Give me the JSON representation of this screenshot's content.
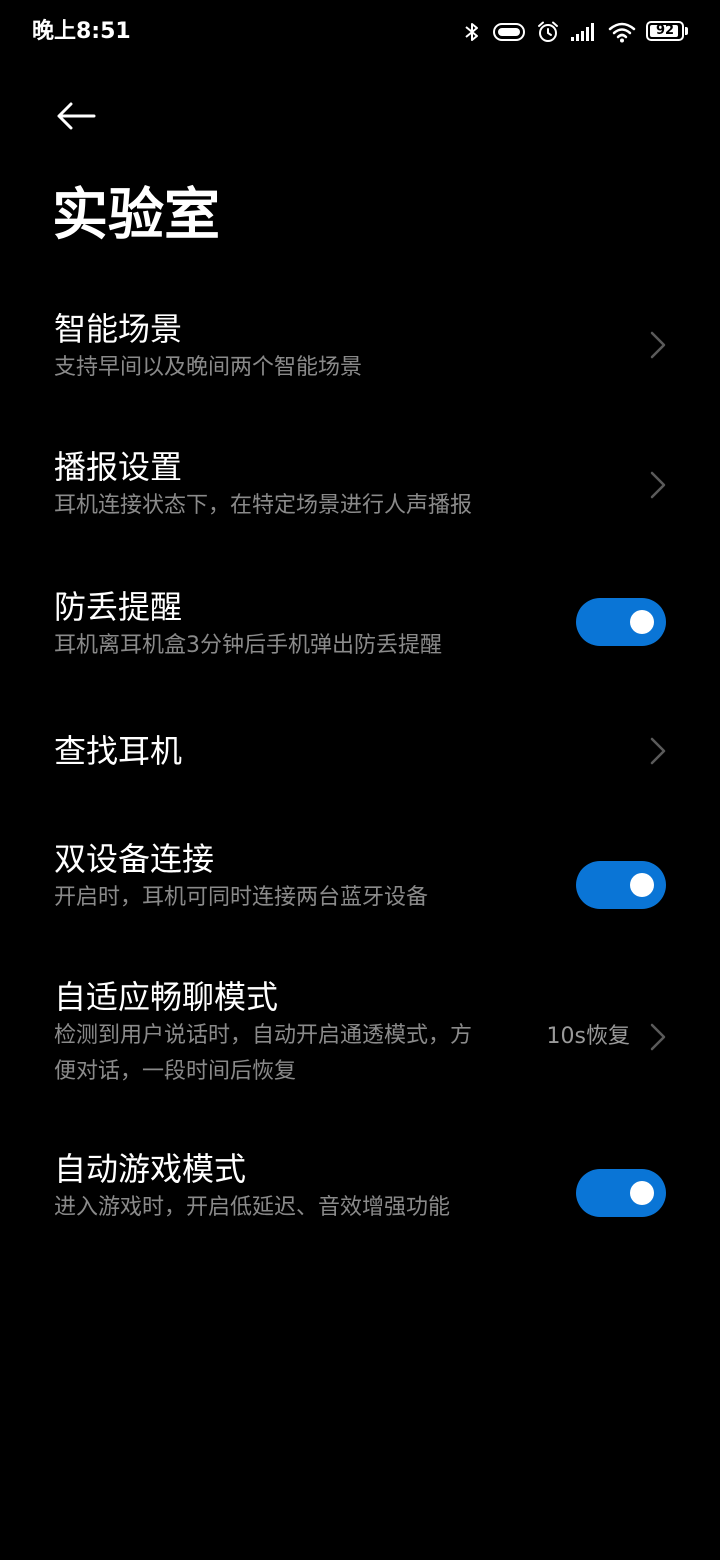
{
  "status_bar": {
    "time": "晚上8:51",
    "battery": {
      "level": 92,
      "label": "92"
    },
    "icons": [
      "bluetooth-icon",
      "headset-battery-icon",
      "alarm-icon",
      "signal-icon",
      "wifi-icon",
      "battery-icon"
    ]
  },
  "header": {
    "back_icon": "arrow-left-icon",
    "title": "实验室"
  },
  "settings": [
    {
      "title": "智能场景",
      "desc": "支持早间以及晚间两个智能场景",
      "control": "chevron"
    },
    {
      "title": "播报设置",
      "desc": "耳机连接状态下，在特定场景进行人声播报",
      "control": "chevron"
    },
    {
      "title": "防丢提醒",
      "desc": "耳机离耳机盒3分钟后手机弹出防丢提醒",
      "control": "toggle",
      "enabled": true
    },
    {
      "title": "查找耳机",
      "desc": "",
      "control": "chevron"
    },
    {
      "title": "双设备连接",
      "desc": "开启时，耳机可同时连接两台蓝牙设备",
      "control": "toggle",
      "enabled": true
    },
    {
      "title": "自适应畅聊模式",
      "desc_line1": "检测到用户说话时，自动开启通透模式，方",
      "desc_line2": "便对话，一段时间后恢复",
      "value": "10s恢复",
      "control": "chevron"
    },
    {
      "title": "自动游戏模式",
      "desc": "进入游戏时，开启低延迟、音效增强功能",
      "control": "toggle",
      "enabled": true
    }
  ],
  "colors": {
    "background": "#000000",
    "toggle_on": "#0a75d6",
    "secondary_text": "#8a8a8a"
  }
}
